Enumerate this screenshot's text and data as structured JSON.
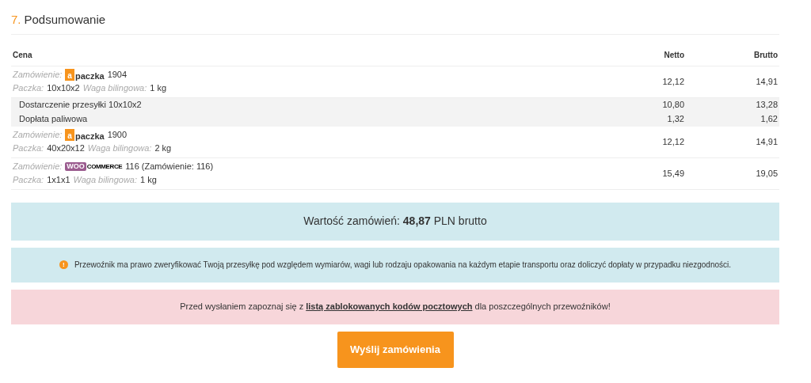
{
  "section": {
    "number": "7.",
    "title": "Podsumowanie"
  },
  "table": {
    "columns": [
      "Cena",
      "Netto",
      "Brutto"
    ],
    "rows": [
      {
        "kind": "order",
        "order_label": "Zamówienie:",
        "logo": {
          "kind": "apaczka",
          "mark": "a",
          "text": "paczka"
        },
        "order_id": "1904",
        "package_label": "Paczka:",
        "package": "10x10x2",
        "weight_label": "Waga bilingowa:",
        "weight": "1 kg",
        "netto": "12,12",
        "brutto": "14,91"
      },
      {
        "kind": "detail",
        "label": "Dostarczenie przesyłki 10x10x2",
        "netto": "10,80",
        "brutto": "13,28"
      },
      {
        "kind": "detail",
        "label": "Dopłata paliwowa",
        "netto": "1,32",
        "brutto": "1,62"
      },
      {
        "kind": "order",
        "order_label": "Zamówienie:",
        "logo": {
          "kind": "apaczka",
          "mark": "a",
          "text": "paczka"
        },
        "order_id": "1900",
        "package_label": "Paczka:",
        "package": "40x20x12",
        "weight_label": "Waga bilingowa:",
        "weight": "2 kg",
        "netto": "12,12",
        "brutto": "14,91"
      },
      {
        "kind": "order",
        "order_label": "Zamówienie:",
        "logo": {
          "kind": "woocommerce",
          "mark": "WOO",
          "text": "COMMERCE"
        },
        "order_id": "116 (Zamówienie: 116)",
        "package_label": "Paczka:",
        "package": "1x1x1",
        "weight_label": "Waga bilingowa:",
        "weight": "1 kg",
        "netto": "15,49",
        "brutto": "19,05"
      }
    ]
  },
  "total": "Wartość zamówień: **48,87** PLN brutto",
  "notice": {
    "icon": "!",
    "text": "Przewoźnik ma prawo zweryfikować Twoją przesyłkę pod względem wymiarów, wagi lub rodzaju opakowania na każdym etapie transportu oraz doliczyć dopłaty w przypadku niezgodności."
  },
  "warning": {
    "before": "Przed wysłaniem zapoznaj się z ",
    "link": "listą zablokowanych kodów pocztowych",
    "after": " dla poszczególnych przewoźników!"
  },
  "submit_button": "Wyślij zamówienia"
}
